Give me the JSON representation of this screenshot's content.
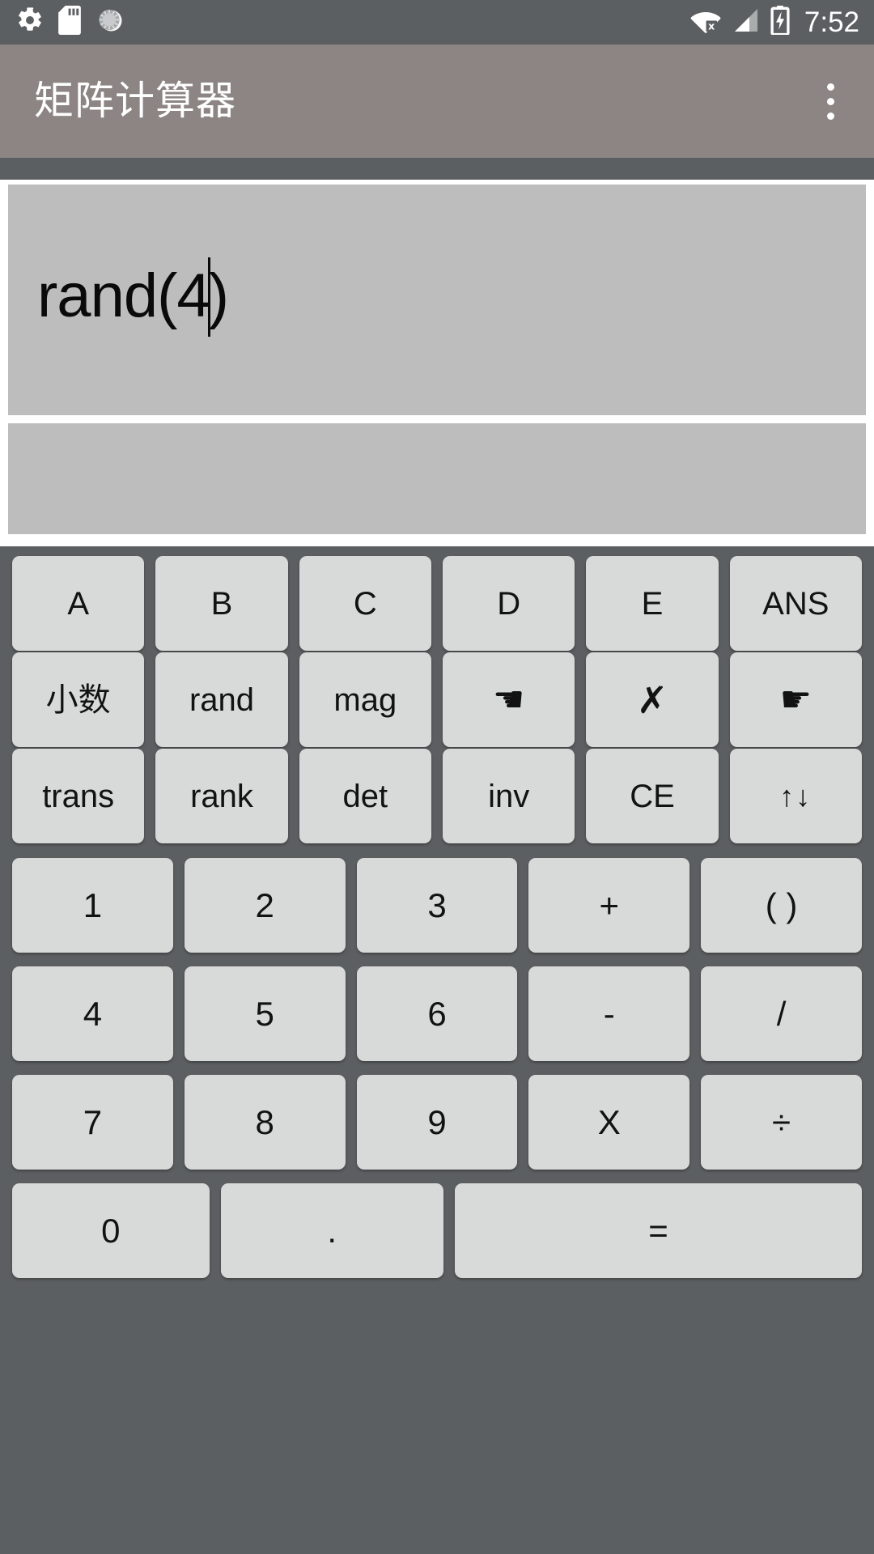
{
  "status_bar": {
    "background_color": "#5c5f61",
    "left_icons": [
      {
        "name": "settings-gear-icon",
        "label": "gear-icon"
      },
      {
        "name": "sd-card-icon",
        "label": "sd-card-icon"
      },
      {
        "name": "sync-progress-icon",
        "label": "circle-progress-icon"
      }
    ],
    "right_icons": [
      {
        "name": "wifi-no-internet-icon",
        "label": "wifi-x-icon"
      },
      {
        "name": "cellular-signal-icon",
        "label": "signal-bars-icon"
      },
      {
        "name": "battery-charging-icon",
        "label": "battery-bolt-icon"
      }
    ],
    "clock": "7:52"
  },
  "app_bar": {
    "background_color": "#8c8584",
    "title": "矩阵计算器",
    "overflow_menu_label": "more-options"
  },
  "display": {
    "background_color": "#bdbdbd",
    "input_expression": "rand(4)",
    "input_before_cursor": "rand(4",
    "input_after_cursor": ")",
    "result_value": ""
  },
  "keypad": {
    "background_color": "#5c5f61",
    "key_color": "#d8dad9",
    "key_text_color": "#121212",
    "rows": [
      {
        "type": "function",
        "keys": [
          {
            "label": "A",
            "name": "key-matrix-a"
          },
          {
            "label": "B",
            "name": "key-matrix-b"
          },
          {
            "label": "C",
            "name": "key-matrix-c"
          },
          {
            "label": "D",
            "name": "key-matrix-d"
          },
          {
            "label": "E",
            "name": "key-matrix-e"
          },
          {
            "label": "ANS",
            "name": "key-ans"
          }
        ]
      },
      {
        "type": "function",
        "keys": [
          {
            "label": "小数",
            "name": "key-decimal-mode"
          },
          {
            "label": "rand",
            "name": "key-rand"
          },
          {
            "label": "mag",
            "name": "key-magnitude"
          },
          {
            "label": "☚",
            "name": "key-cursor-left",
            "icon": "hand-point-left-icon"
          },
          {
            "label": "✗",
            "name": "key-delete",
            "icon": "x-cross-icon"
          },
          {
            "label": "☛",
            "name": "key-cursor-right",
            "icon": "hand-point-right-icon"
          }
        ]
      },
      {
        "type": "function",
        "keys": [
          {
            "label": "trans",
            "name": "key-transpose"
          },
          {
            "label": "rank",
            "name": "key-rank"
          },
          {
            "label": "det",
            "name": "key-determinant"
          },
          {
            "label": "inv",
            "name": "key-inverse"
          },
          {
            "label": "CE",
            "name": "key-clear-entry"
          },
          {
            "label": "↑↓",
            "name": "key-scroll-updown",
            "icon": "up-down-arrows-icon"
          }
        ]
      },
      {
        "type": "numeric",
        "keys": [
          {
            "label": "1",
            "name": "key-1"
          },
          {
            "label": "2",
            "name": "key-2"
          },
          {
            "label": "3",
            "name": "key-3"
          },
          {
            "label": "+",
            "name": "key-plus"
          },
          {
            "label": "( )",
            "name": "key-parentheses"
          }
        ]
      },
      {
        "type": "numeric",
        "keys": [
          {
            "label": "4",
            "name": "key-4"
          },
          {
            "label": "5",
            "name": "key-5"
          },
          {
            "label": "6",
            "name": "key-6"
          },
          {
            "label": "-",
            "name": "key-minus"
          },
          {
            "label": "/",
            "name": "key-slash"
          }
        ]
      },
      {
        "type": "numeric",
        "keys": [
          {
            "label": "7",
            "name": "key-7"
          },
          {
            "label": "8",
            "name": "key-8"
          },
          {
            "label": "9",
            "name": "key-9"
          },
          {
            "label": "X",
            "name": "key-multiply"
          },
          {
            "label": "÷",
            "name": "key-divide"
          }
        ]
      },
      {
        "type": "last",
        "keys": [
          {
            "label": "0",
            "name": "key-0"
          },
          {
            "label": ".",
            "name": "key-decimal-point"
          },
          {
            "label": "=",
            "name": "key-equals"
          }
        ]
      }
    ]
  }
}
